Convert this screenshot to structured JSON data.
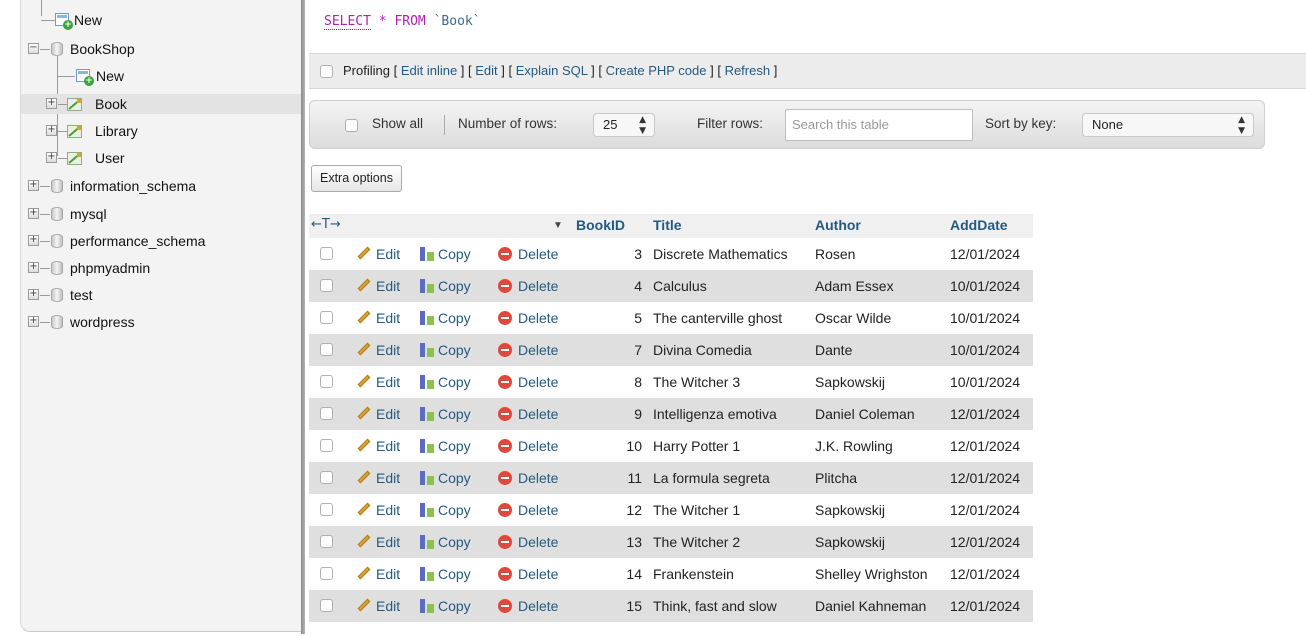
{
  "navigation": {
    "top_new": "New",
    "database": "BookShop",
    "db_new": "New",
    "tables": [
      "Book",
      "Library",
      "User"
    ],
    "other_databases": [
      "information_schema",
      "mysql",
      "performance_schema",
      "phpmyadmin",
      "test",
      "wordpress"
    ]
  },
  "sql": {
    "select": "SELECT",
    "star": "*",
    "from": "FROM",
    "table": "`Book`"
  },
  "profiling": {
    "label": "Profiling",
    "links": [
      "Edit inline",
      "Edit",
      "Explain SQL",
      "Create PHP code",
      "Refresh"
    ]
  },
  "controls": {
    "show_all": "Show all",
    "rows_label": "Number of rows:",
    "rows_value": "25",
    "filter_label": "Filter rows:",
    "filter_placeholder": "Search this table",
    "sort_label": "Sort by key:",
    "sort_value": "None",
    "extra_options": "Extra options"
  },
  "table": {
    "nav_arrows": "←T→",
    "columns": [
      "BookID",
      "Title",
      "Author",
      "AddDate"
    ],
    "actions": {
      "edit": "Edit",
      "copy": "Copy",
      "delete": "Delete"
    },
    "rows": [
      {
        "id": "3",
        "title": "Discrete Mathematics",
        "author": "Rosen",
        "date": "12/01/2024"
      },
      {
        "id": "4",
        "title": "Calculus",
        "author": "Adam Essex",
        "date": "10/01/2024"
      },
      {
        "id": "5",
        "title": "The canterville ghost",
        "author": "Oscar Wilde",
        "date": "10/01/2024"
      },
      {
        "id": "7",
        "title": "Divina Comedia",
        "author": "Dante",
        "date": "10/01/2024"
      },
      {
        "id": "8",
        "title": "The Witcher 3",
        "author": "Sapkowskij",
        "date": "10/01/2024"
      },
      {
        "id": "9",
        "title": "Intelligenza emotiva",
        "author": "Daniel Coleman",
        "date": "12/01/2024"
      },
      {
        "id": "10",
        "title": "Harry Potter 1",
        "author": "J.K. Rowling",
        "date": "12/01/2024"
      },
      {
        "id": "11",
        "title": "La formula segreta",
        "author": "Plitcha",
        "date": "12/01/2024"
      },
      {
        "id": "12",
        "title": "The Witcher 1",
        "author": "Sapkowskij",
        "date": "12/01/2024"
      },
      {
        "id": "13",
        "title": "The Witcher 2",
        "author": "Sapkowskij",
        "date": "12/01/2024"
      },
      {
        "id": "14",
        "title": "Frankenstein",
        "author": "Shelley Wrighston",
        "date": "12/01/2024"
      },
      {
        "id": "15",
        "title": "Think, fast and slow",
        "author": "Daniel Kahneman",
        "date": "12/01/2024"
      }
    ]
  }
}
